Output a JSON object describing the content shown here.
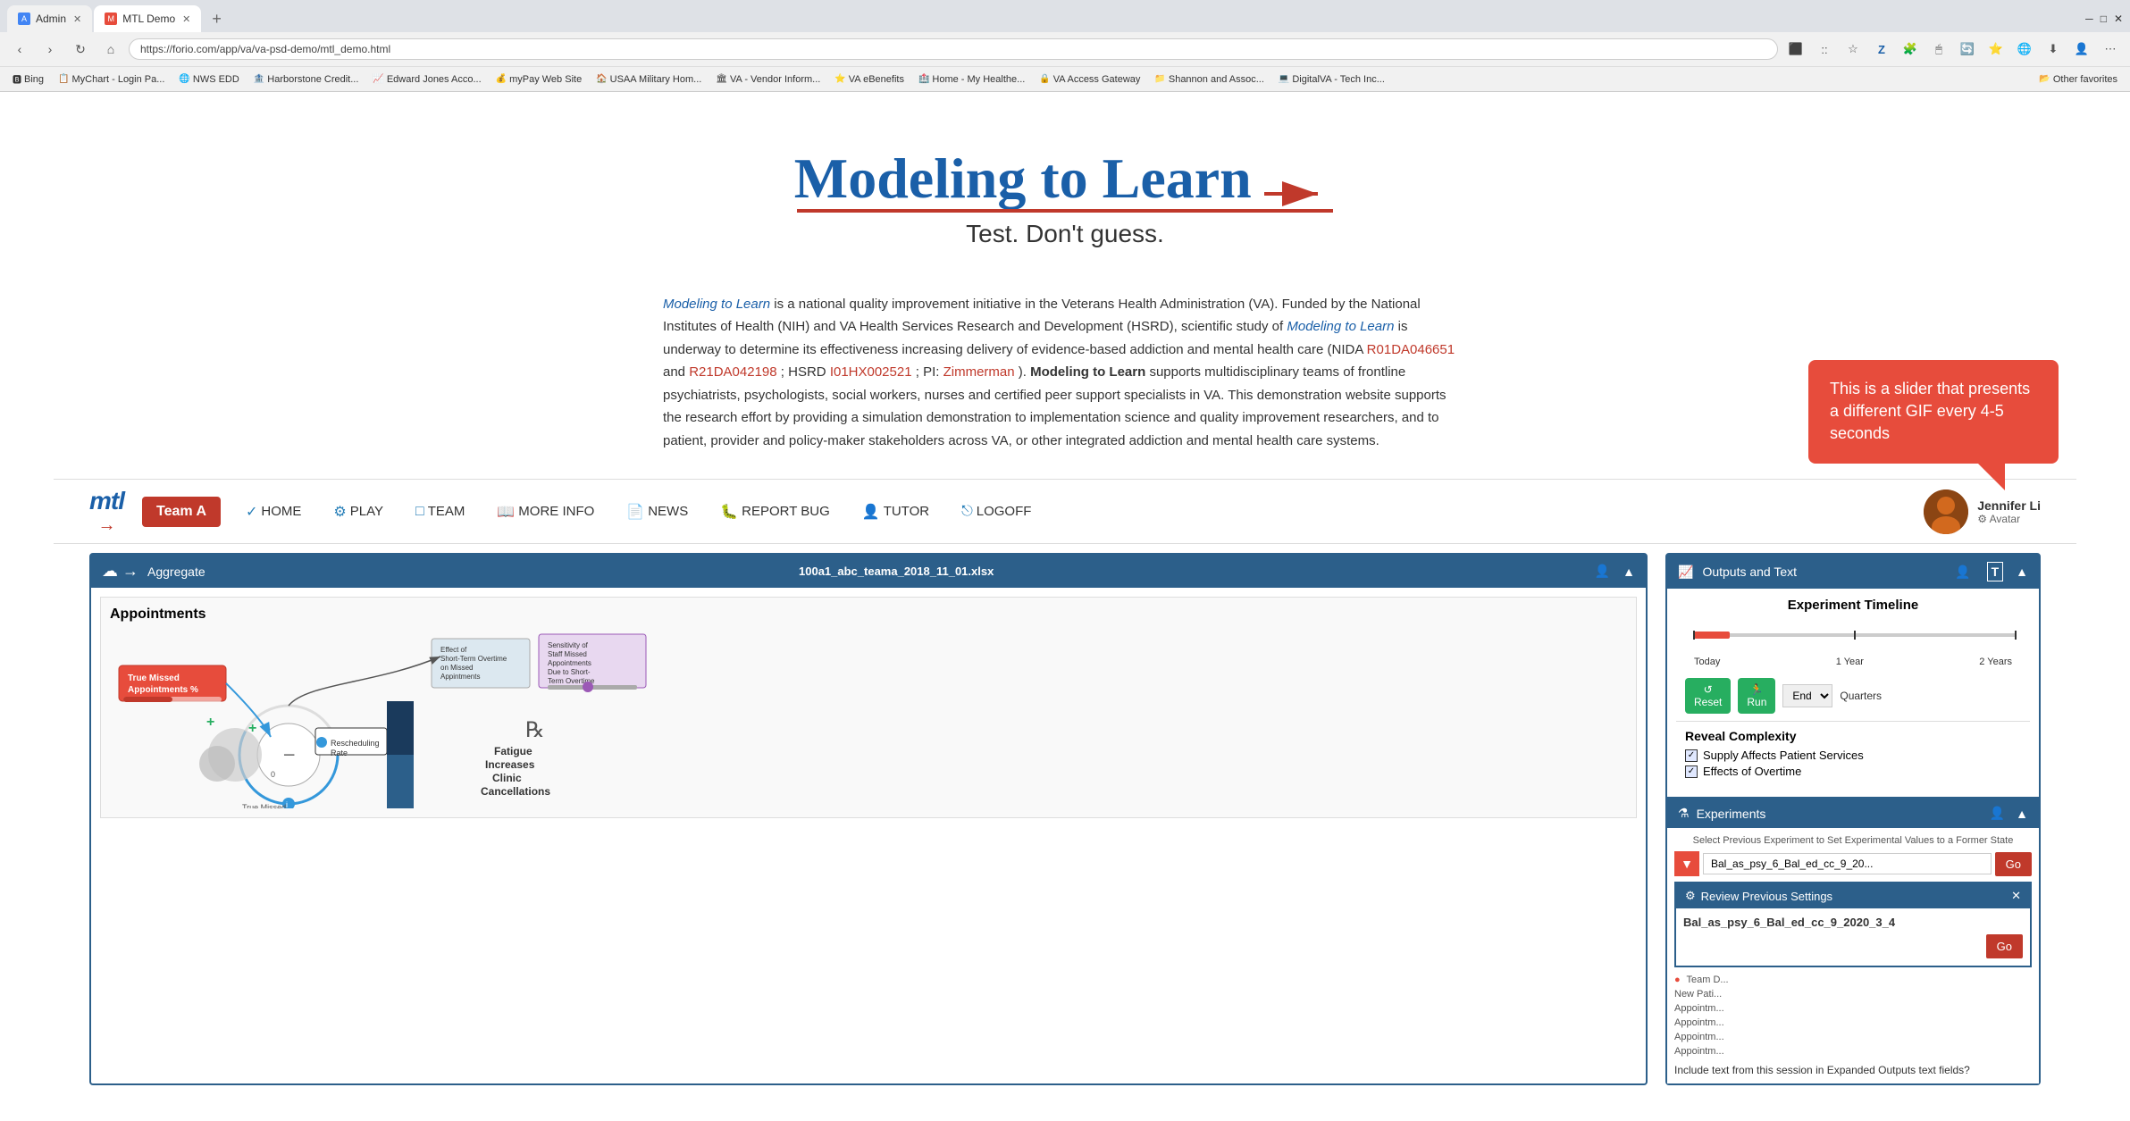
{
  "browser": {
    "tabs": [
      {
        "label": "Admin",
        "active": false,
        "favicon": "A"
      },
      {
        "label": "MTL Demo",
        "active": true,
        "favicon": "M"
      }
    ],
    "url": "https://forio.com/app/va/va-psd-demo/mtl_demo.html",
    "bookmarks": [
      {
        "label": "Bing",
        "icon": "🅱"
      },
      {
        "label": "MyChart - Login Pa...",
        "icon": "📋"
      },
      {
        "label": "NWS EDD",
        "icon": "🌐"
      },
      {
        "label": "Harborstone Credit...",
        "icon": "🏦"
      },
      {
        "label": "Edward Jones Acco...",
        "icon": "📈"
      },
      {
        "label": "myPay Web Site",
        "icon": "💰"
      },
      {
        "label": "USAA Military Hom...",
        "icon": "🏠"
      },
      {
        "label": "VA - Vendor Inform...",
        "icon": "🏛"
      },
      {
        "label": "VA eBenefits",
        "icon": "⭐"
      },
      {
        "label": "Home - My Healthe...",
        "icon": "🏥"
      },
      {
        "label": "VA Access Gateway",
        "icon": "🔒"
      },
      {
        "label": "Shannon and Assoc...",
        "icon": "📁"
      },
      {
        "label": "DigitalVA - Tech Inc...",
        "icon": "💻"
      },
      {
        "label": "Other favorites",
        "icon": "📂"
      }
    ]
  },
  "page": {
    "title": "Modeling to Learn",
    "subtitle": "Test. Don't guess.",
    "description_parts": {
      "intro_italic": "Modeling to Learn",
      "intro_rest": " is a national quality improvement initiative in the Veterans Health Administration (VA). Funded by the National Institutes of Health (NIH) and VA Health Services Research and Development (HSRD), scientific study of ",
      "mtl_italic": "Modeling to Learn",
      "after_mtl": " is underway to determine its effectiveness increasing delivery of evidence-based addiction and mental health care (NIDA ",
      "link1": "R01DA046651",
      "and": " and ",
      "link2": "R21DA042198",
      "hsrd": " ; HSRD ",
      "link3": "I01HX002521",
      "pi": " ; PI: ",
      "link4": "Zimmerman",
      "close": " ). ",
      "mtl_bold": "Modeling to Learn",
      "rest": " supports multidisciplinary teams of frontline psychiatrists, psychologists, social workers, nurses and certified peer support specialists in VA. This demonstration website supports the research effort by providing a simulation demonstration to implementation science and quality improvement researchers, and to patient, provider and policy-maker stakeholders across VA, or other integrated addiction and mental health care systems."
    },
    "tooltip": "This is a slider that presents a different GIF every 4-5 seconds"
  },
  "nav": {
    "logo": "mtl",
    "team": "Team A",
    "items": [
      {
        "label": "HOME",
        "icon": "✓"
      },
      {
        "label": "PLAY",
        "icon": "⚙"
      },
      {
        "label": "TEAM",
        "icon": "□"
      },
      {
        "label": "MORE INFO",
        "icon": "□"
      },
      {
        "label": "NEWS",
        "icon": "□"
      },
      {
        "label": "REPORT BUG",
        "icon": "🐛"
      },
      {
        "label": "TUTOR",
        "icon": "👤"
      },
      {
        "label": "LOGOFF",
        "icon": "⎋"
      }
    ],
    "user": {
      "name": "Jennifer Li",
      "avatar_label": "Avatar"
    }
  },
  "left_panel": {
    "header": {
      "icon": "☁",
      "label": "Aggregate",
      "filename": "100a1_abc_teama_2018_11_01.xlsx"
    }
  },
  "right_panel": {
    "header": {
      "icon": "📈",
      "label": "Outputs and Text"
    },
    "timeline": {
      "title": "Experiment Timeline",
      "labels": [
        "Today",
        "1 Year",
        "2 Years"
      ],
      "reset_label": "Reset",
      "run_label": "Run",
      "end_label": "End",
      "quarters_label": "Quarters"
    },
    "reveal": {
      "title": "Reveal Complexity",
      "items": [
        {
          "label": "Supply Affects Patient Services",
          "checked": true
        },
        {
          "label": "Effects of Overtime",
          "checked": true
        }
      ]
    },
    "experiments": {
      "header": "Experiments",
      "select_label": "Select Previous Experiment to Set Experimental Values to a Former State",
      "dropdown_value": "Bal_as_psy_6_Bal_ed_cc_9_20...",
      "go_btn": "Go",
      "review_title": "Review Previous Settings",
      "review_value": "Bal_as_psy_6_Bal_ed_cc_9_2020_3_4",
      "review_go": "Go",
      "list_items": [
        "Team D...",
        "New Pati...",
        "Appointm...",
        "Appointm...",
        "Appointm...",
        "Appointm..."
      ],
      "include_label": "Include text from this session in Expanded Outputs text fields?"
    }
  }
}
